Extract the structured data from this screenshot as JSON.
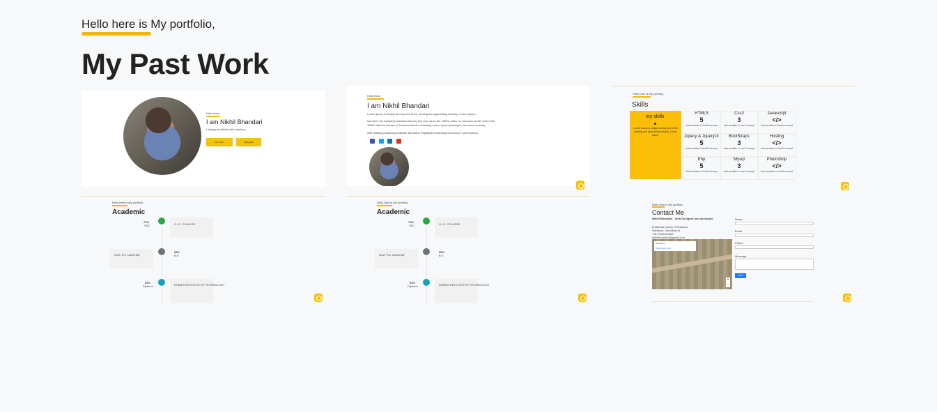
{
  "header": {
    "greeting": "Hello here is My portfolio,",
    "title": "My Past Work"
  },
  "colors": {
    "accent": "#f2b705",
    "gear": "#f5c20a",
    "green": "#28a745",
    "gray": "#6c757d",
    "teal": "#17a2b8",
    "blue": "#1e7bff"
  },
  "cards": {
    "home1": {
      "hello": "Hello there",
      "name": "I am Nikhil Bhandari",
      "desc": "I design and build web solutions",
      "btn1": "CONTACT",
      "btn2": "RESUME",
      "icon": "settings-gear-icon"
    },
    "home2": {
      "hello": "Hello there",
      "name": "I am Nikhil Bhandari",
      "p1": "Lorem Ipsum is simply dummy text of the printing and typesetting industry. Lorem Ipsum",
      "p2": "has been the industry's standard dummy text ever since the 1500s, when an unknown printer took a the",
      "p3": "1500s with the release of Letraset sheets containing Lorem Ipsum passages, and more recently",
      "p4": "with desktop publishing software like Aldus PageMaker including versions of Lorem Ipsum.",
      "socials": [
        "facebook-icon",
        "twitter-icon",
        "linkedin-icon",
        "youtube-icon"
      ],
      "icon": "settings-gear-icon"
    },
    "skills": {
      "hello": "Hello here is My portfolio,",
      "title": "Skills",
      "my_skills": "my skills",
      "my_skills_desc": "Lorem Ipsum is simply dummy text of the printing and typesetting industry. Lorem Ipsum.",
      "items": [
        {
          "name": "HTML5",
          "glyph": "5",
          "level": "Intermediate in html5 concept"
        },
        {
          "name": "Css3",
          "glyph": "3",
          "level": "Intermediate in css3 concept"
        },
        {
          "name": "Javascript",
          "glyph": "</>",
          "level": "Intermediate in html5 concept"
        },
        {
          "name": "Jquery & JqueryUI",
          "glyph": "5",
          "level": "Intermediate in html5 concept"
        },
        {
          "name": "BootStraps",
          "glyph": "3",
          "level": "Intermediate in css3 concept"
        },
        {
          "name": "Hosting",
          "glyph": "</>",
          "level": "Intermediate in html5 concept"
        },
        {
          "name": "Php",
          "glyph": "5",
          "level": "Intermediate in html5 concept"
        },
        {
          "name": "Mysql",
          "glyph": "3",
          "level": "Intermediate in css3 concept"
        },
        {
          "name": "Photoshop",
          "glyph": "</>",
          "level": "Intermediate in html5 concept"
        }
      ],
      "icon": "settings-gear-icon"
    },
    "academic1": {
      "hello": "Hello here is My portfolio,",
      "title": "Academic",
      "row1_pct": "74%",
      "row1_lvl": "SSC",
      "row1_school": "G.I.C. COLLEGE",
      "row2_school": "Govt. Pro. University",
      "row2_pct": "68%",
      "row2_lvl": "B.E",
      "row3_pct": "82%",
      "row3_lvl": "Diploma",
      "row3_school": "DHANVI INSTITUTE OF TECHNOLOGY",
      "icon": "settings-gear-icon"
    },
    "academic2": {
      "hello": "Hello here is My portfolio,",
      "title": "Academic",
      "row1_pct": "74%",
      "row1_lvl": "SSC",
      "row1_school": "G.I.C. COLLEGE",
      "row2_school": "Govt. Pro. University",
      "row2_pct": "68%",
      "row2_lvl": "B.E",
      "row3_pct": "82%",
      "row3_lvl": "Diploma",
      "row3_school": "DHANVI INSTITUTE OF TECHNOLOGY",
      "icon": "settings-gear-icon"
    },
    "contact": {
      "hello": "Hello here is My portfolio,",
      "title": "Contact Me",
      "subtitle": "Nikhil Bhandari - Web Designer and developer",
      "address": "B Mahara colony, Shivanand,",
      "city": "Haridwar, Uttarakhand",
      "phone": "+91-7500432842",
      "email": "nikhilbhandari@gmail.com",
      "map_label": "Directions",
      "view_larger": "View larger map",
      "fields": [
        "Name",
        "Email",
        "Phone",
        "Message"
      ],
      "send": "Send",
      "icon": "settings-gear-icon"
    }
  }
}
